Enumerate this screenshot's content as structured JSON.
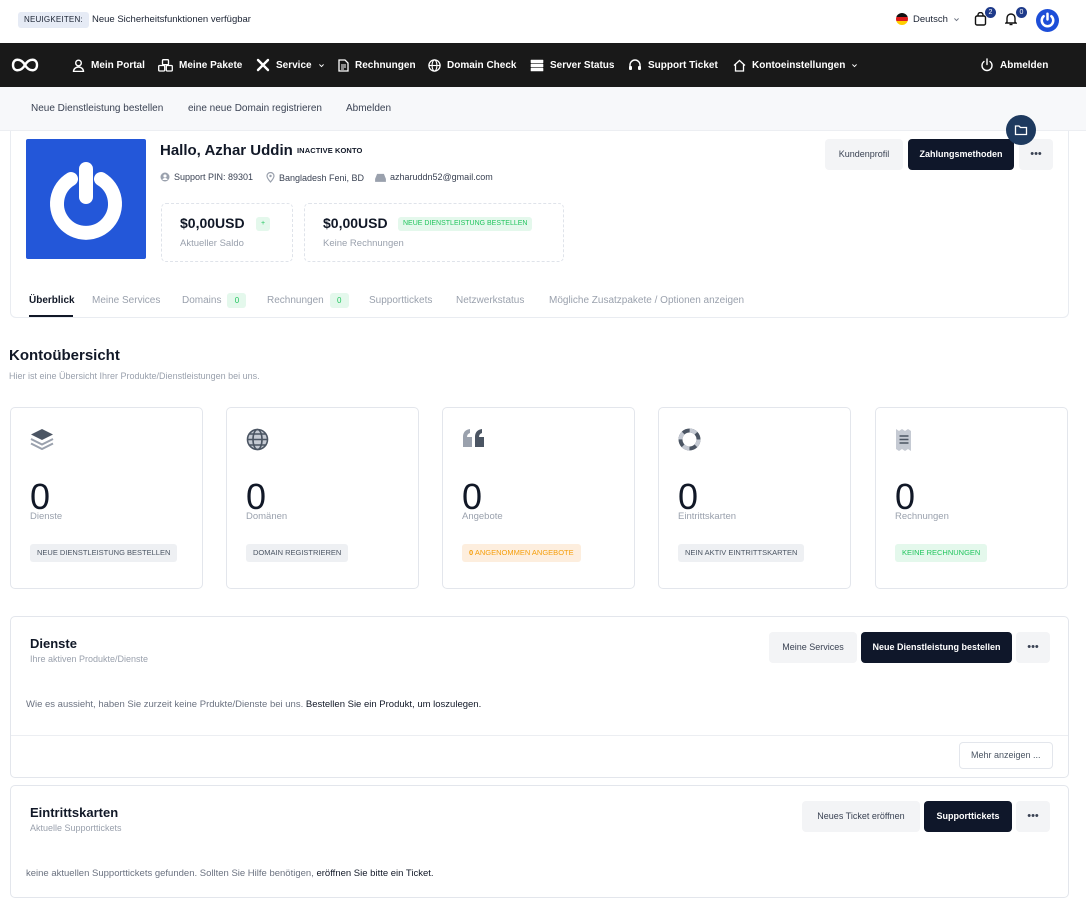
{
  "topbar": {
    "news_badge": "NEUIGKEITEN:",
    "news_text": "Neue Sicherheitsfunktionen verfügbar",
    "language": "Deutsch",
    "cart_count": "2",
    "notification_count": "0",
    "accent_color": "#1d4ed8"
  },
  "nav": {
    "items": [
      {
        "label": "Mein Portal",
        "icon": "user-icon"
      },
      {
        "label": "Meine Pakete",
        "icon": "cubes-icon"
      },
      {
        "label": "Service",
        "icon": "tools-icon"
      },
      {
        "label": "Rechnungen",
        "icon": "document-icon"
      },
      {
        "label": "Domain Check",
        "icon": "globe-icon"
      },
      {
        "label": "Server Status",
        "icon": "server-icon"
      },
      {
        "label": "Support Ticket",
        "icon": "headset-icon"
      },
      {
        "label": "Kontoeinstellungen",
        "icon": "home-icon"
      }
    ],
    "logout": "Abmelden",
    "background": "#191919"
  },
  "subnav": {
    "items": [
      "Neue Dienstleistung bestellen",
      "eine neue Domain registrieren",
      "Abmelden"
    ]
  },
  "profile": {
    "greeting": "Hallo, Azhar Uddin",
    "status": "INACTIVE KONTO",
    "support_pin": "Support PIN: 89301",
    "location": "Bangladesh Feni, BD",
    "email": "azharuddn52@gmail.com",
    "balance": {
      "value": "$0,00USD",
      "label": "Aktueller Saldo",
      "tag": "+"
    },
    "invoices": {
      "value": "$0,00USD",
      "label": "Keine Rechnungen",
      "tag": "NEUE DIENSTLEISTUNG BESTELLEN"
    },
    "btn_profile": "Kundenprofil",
    "btn_payment": "Zahlungsmethoden",
    "btn_more": "•••"
  },
  "tabs": [
    {
      "label": "Überblick"
    },
    {
      "label": "Meine Services"
    },
    {
      "label": "Domains",
      "count": "0"
    },
    {
      "label": "Rechnungen",
      "count": "0"
    },
    {
      "label": "Supporttickets"
    },
    {
      "label": "Netzwerkstatus"
    },
    {
      "label": "Mögliche Zusatzpakete / Optionen anzeigen"
    }
  ],
  "overview": {
    "title": "Kontoübersicht",
    "subtitle": "Hier ist eine Übersicht Ihrer Produkte/Dienstleistungen bei uns.",
    "stats": [
      {
        "value": "0",
        "label": "Dienste",
        "tag": "NEUE DIENSTLEISTUNG BESTELLEN",
        "icon": "layers-icon"
      },
      {
        "value": "0",
        "label": "Domänen",
        "tag": "DOMAIN REGISTRIEREN",
        "icon": "globe-icon"
      },
      {
        "value": "0",
        "label": "Angebote",
        "tag_count": "0",
        "tag": "ANGENOMMEN ANGEBOTE",
        "icon": "quote-icon"
      },
      {
        "value": "0",
        "label": "Eintrittskarten",
        "tag": "NEIN AKTIV EINTRITTSKARTEN",
        "icon": "lifebuoy-icon"
      },
      {
        "value": "0",
        "label": "Rechnungen",
        "tag": "KEINE RECHNUNGEN",
        "icon": "receipt-icon"
      }
    ]
  },
  "services_panel": {
    "title": "Dienste",
    "subtitle": "Ihre aktiven Produkte/Dienste",
    "btn_services": "Meine Services",
    "btn_order": "Neue Dienstleistung bestellen",
    "btn_more": "•••",
    "text": "Wie es aussieht, haben Sie zurzeit keine Prdukte/Dienste bei uns.",
    "link": "Bestellen Sie ein Produkt, um loszulegen.",
    "show_more": "Mehr anzeigen ..."
  },
  "tickets_panel": {
    "title": "Eintrittskarten",
    "subtitle": "Aktuelle Supporttickets",
    "btn_new": "Neues Ticket eröffnen",
    "btn_tickets": "Supporttickets",
    "btn_more": "•••",
    "text": "keine aktuellen Supporttickets gefunden. Sollten Sie Hilfe benötigen,",
    "link": "eröffnen Sie bitte ein Ticket."
  }
}
